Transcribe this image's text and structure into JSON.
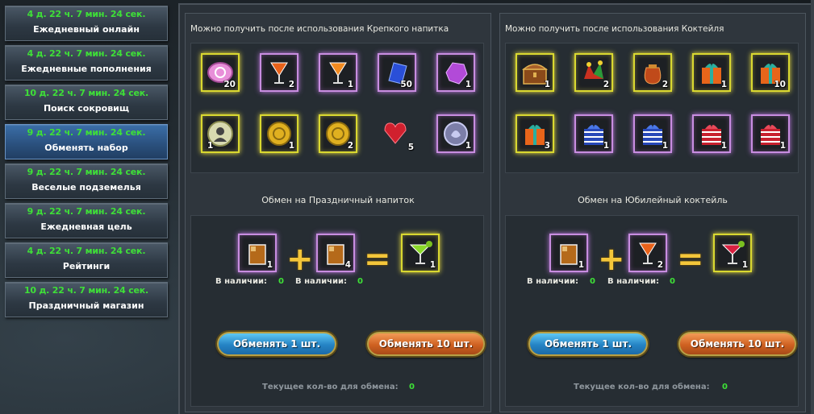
{
  "sidebar": {
    "items": [
      {
        "timer": "4 д. 22 ч. 7 мин. 24 сек.",
        "label": "Ежедневный онлайн"
      },
      {
        "timer": "4 д. 22 ч. 7 мин. 24 сек.",
        "label": "Ежедневные пополнения"
      },
      {
        "timer": "10 д. 22 ч. 7 мин. 24 сек.",
        "label": "Поиск сокровищ"
      },
      {
        "timer": "9 д. 22 ч. 7 мин. 24 сек.",
        "label": "Обменять набор",
        "active": true
      },
      {
        "timer": "9 д. 22 ч. 7 мин. 24 сек.",
        "label": "Веселые подземелья"
      },
      {
        "timer": "9 д. 22 ч. 7 мин. 24 сек.",
        "label": "Ежедневная цель"
      },
      {
        "timer": "4 д. 22 ч. 7 мин. 24 сек.",
        "label": "Рейтинги"
      },
      {
        "timer": "10 д. 22 ч. 7 мин. 24 сек.",
        "label": "Праздничный магазин"
      }
    ]
  },
  "panels": [
    {
      "title": "Можно получить после использования Крепкого напитка",
      "rewards_row1": [
        {
          "icon": "pink-token-icon",
          "count": "20",
          "rarity": "gold"
        },
        {
          "icon": "cocktail-glass-icon",
          "count": "2",
          "rarity": "purple"
        },
        {
          "icon": "cocktail-glass-icon",
          "count": "1",
          "rarity": "purple"
        },
        {
          "icon": "blue-crystal-icon",
          "count": "50",
          "rarity": "purple"
        },
        {
          "icon": "purple-gem-icon",
          "count": "1",
          "rarity": "purple"
        }
      ],
      "rewards_row2": [
        {
          "icon": "portrait-coin-icon",
          "count": "1",
          "rarity": "gold"
        },
        {
          "icon": "gold-coin-icon",
          "count": "1",
          "rarity": "gold"
        },
        {
          "icon": "gold-coin-icon",
          "count": "2",
          "rarity": "gold"
        },
        {
          "icon": "red-heart-gem-icon",
          "count": "5",
          "rarity": "purple"
        },
        {
          "icon": "silver-emblem-icon",
          "count": "1",
          "rarity": "purple"
        }
      ],
      "exchange_title": "Обмен на Праздничный напиток",
      "ingredient1": {
        "icon": "whiskey-glass-icon",
        "count": "1",
        "avail_label": "В наличии:",
        "avail_value": "0"
      },
      "ingredient2": {
        "icon": "whiskey-glass-icon",
        "count": "4",
        "avail_label": "В наличии:",
        "avail_value": "0"
      },
      "result": {
        "icon": "green-margarita-icon",
        "count": "1"
      },
      "plus": "+",
      "equals": "=",
      "btn1": "Обменять 1 шт.",
      "btn10": "Обменять 10 шт.",
      "current_label": "Текущее кол-во для обмена:",
      "current_value": "0"
    },
    {
      "title": "Можно получить после использования Коктейля",
      "rewards_row1": [
        {
          "icon": "treasure-chest-icon",
          "count": "1",
          "rarity": "gold"
        },
        {
          "icon": "jester-hat-icon",
          "count": "2",
          "rarity": "gold"
        },
        {
          "icon": "loot-bag-icon",
          "count": "2",
          "rarity": "gold"
        },
        {
          "icon": "orange-gift-icon",
          "count": "1",
          "rarity": "gold"
        },
        {
          "icon": "orange-gift-icon",
          "count": "10",
          "rarity": "gold"
        }
      ],
      "rewards_row2": [
        {
          "icon": "orange-gift-icon",
          "count": "3",
          "rarity": "gold"
        },
        {
          "icon": "blue-gift-icon",
          "count": "1",
          "rarity": "purple"
        },
        {
          "icon": "blue-gift-icon",
          "count": "1",
          "rarity": "purple"
        },
        {
          "icon": "red-gift-icon",
          "count": "1",
          "rarity": "purple"
        },
        {
          "icon": "red-gift-icon",
          "count": "1",
          "rarity": "purple"
        }
      ],
      "exchange_title": "Обмен на Юбилейный коктейль",
      "ingredient1": {
        "icon": "whiskey-glass-icon",
        "count": "1",
        "avail_label": "В наличии:",
        "avail_value": "0"
      },
      "ingredient2": {
        "icon": "cocktail-glass-icon",
        "count": "2",
        "avail_label": "В наличии:",
        "avail_value": "0"
      },
      "result": {
        "icon": "red-cosmo-icon",
        "count": "1"
      },
      "plus": "+",
      "equals": "=",
      "btn1": "Обменять 1 шт.",
      "btn10": "Обменять 10 шт.",
      "current_label": "Текущее кол-во для обмена:",
      "current_value": "0"
    }
  ],
  "colors": {
    "timer_green": "#3ee037",
    "gold_frame": "#d9d830",
    "purple_frame": "#c88de0",
    "button_blue": "#2583c4",
    "button_orange": "#cf6121"
  }
}
